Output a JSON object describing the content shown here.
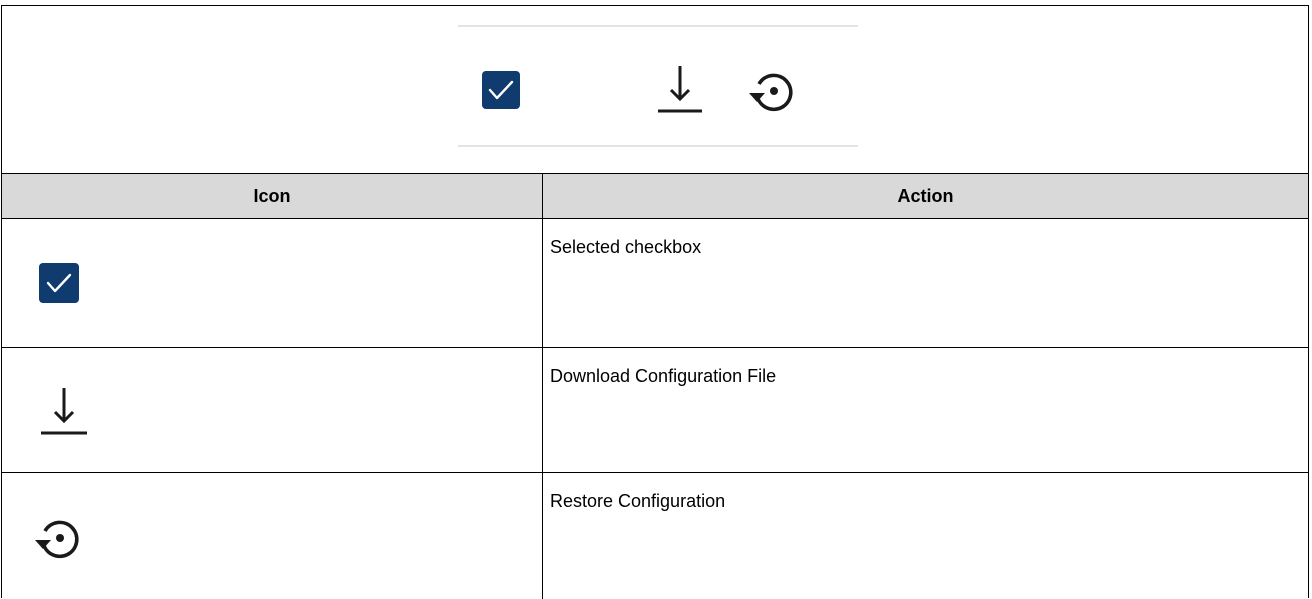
{
  "preview": {
    "icons": [
      "checkbox-checked-icon",
      "download-icon",
      "restore-icon"
    ]
  },
  "table": {
    "headers": {
      "icon": "Icon",
      "action": "Action"
    },
    "rows": [
      {
        "icon": "checkbox-checked-icon",
        "action": "Selected checkbox"
      },
      {
        "icon": "download-icon",
        "action": "Download Configuration File"
      },
      {
        "icon": "restore-icon",
        "action": "Restore Configuration"
      }
    ]
  },
  "colors": {
    "checkbox_fill": "#0f3b6e",
    "header_bg": "#d9d9d9",
    "divider": "#e4e4e4",
    "icon": "#1a1a1a"
  }
}
